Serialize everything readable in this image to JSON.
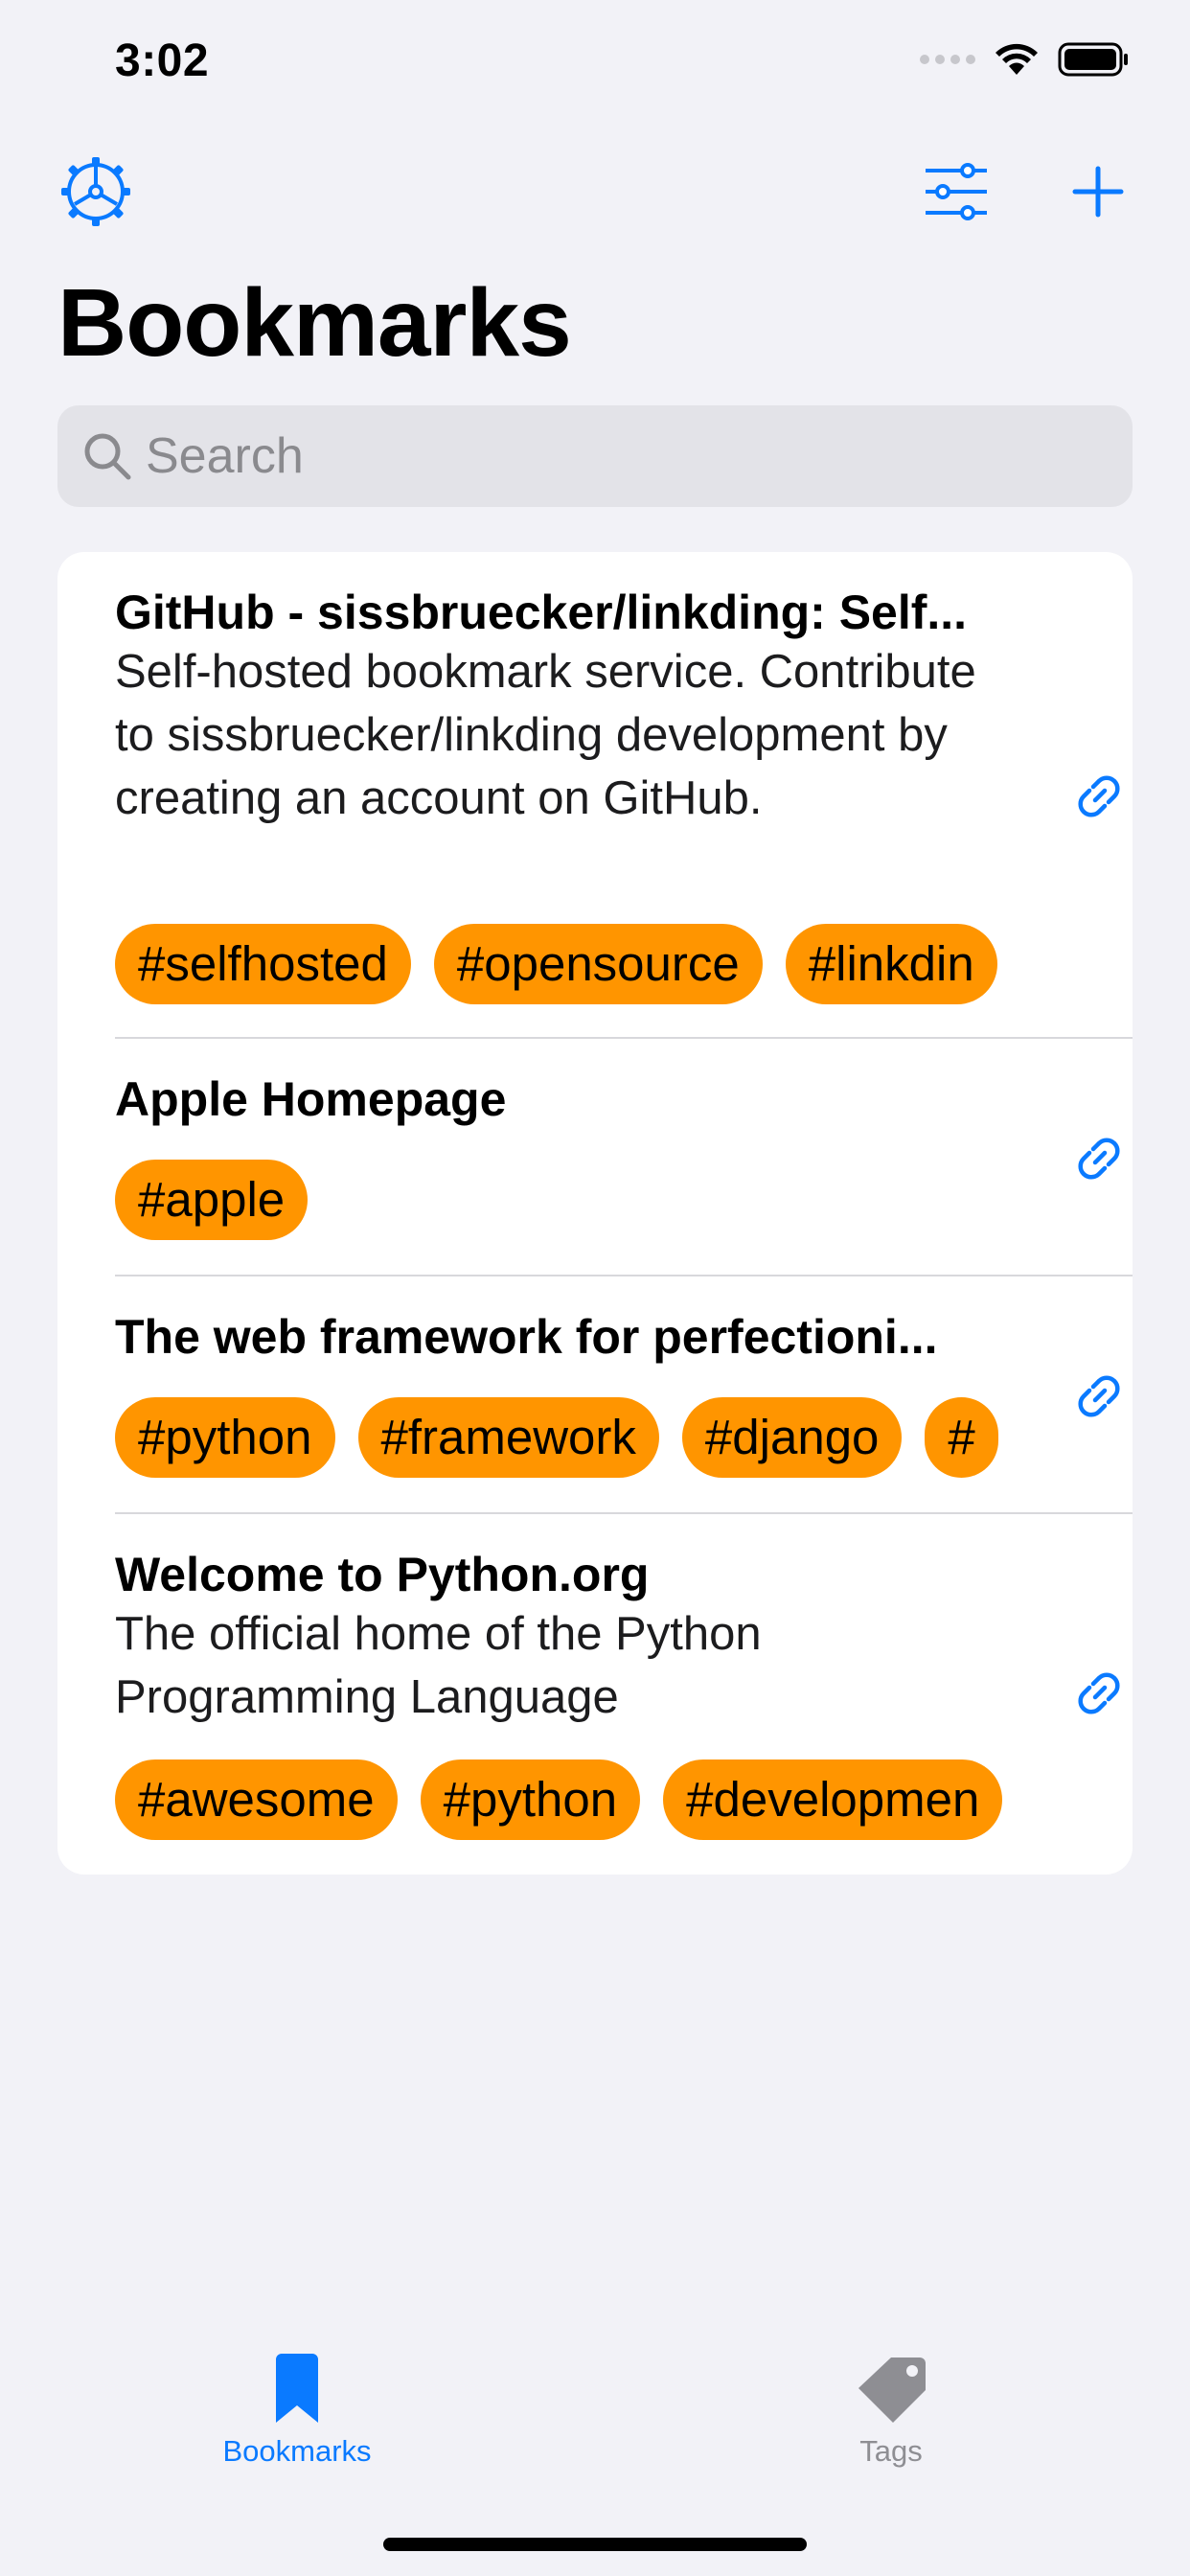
{
  "status_bar": {
    "time": "3:02"
  },
  "navigation": {
    "settings_icon": "gear-icon",
    "filter_icon": "sliders-icon",
    "add_icon": "plus-icon",
    "title": "Bookmarks"
  },
  "search": {
    "placeholder": "Search"
  },
  "bookmarks": [
    {
      "title": "GitHub - sissbruecker/linkding: Self...",
      "description": "Self-hosted bookmark service. Contribute to sissbruecker/linkding development by creating an account on GitHub.",
      "tags": [
        "#selfhosted",
        "#opensource",
        "#linkdin"
      ]
    },
    {
      "title": "Apple Homepage",
      "description": "",
      "tags": [
        "#apple"
      ]
    },
    {
      "title": "The web framework for perfectioni...",
      "description": "",
      "tags": [
        "#python",
        "#framework",
        "#django",
        "#"
      ]
    },
    {
      "title": "Welcome to Python.org",
      "description": "The official home of the Python Programming Language",
      "tags": [
        "#awesome",
        "#python",
        "#developmen"
      ]
    }
  ],
  "tab_bar": {
    "items": [
      {
        "label": "Bookmarks",
        "icon": "bookmark-icon",
        "selected": true
      },
      {
        "label": "Tags",
        "icon": "tag-icon",
        "selected": false
      }
    ]
  },
  "colors": {
    "accent": "#0a7aff",
    "tag_background": "#ff9500",
    "background": "#f2f2f7"
  }
}
